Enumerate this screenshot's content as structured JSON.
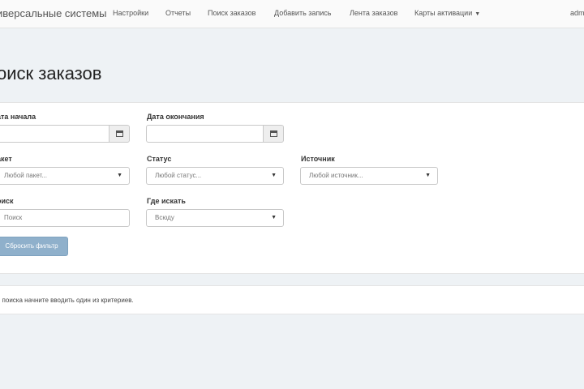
{
  "navbar": {
    "brand": "иверсальные системы",
    "items": [
      "Настройки",
      "Отчеты",
      "Поиск заказов",
      "Добавить запись",
      "Лента заказов",
      "Карты активации"
    ],
    "user": "adm"
  },
  "page_title": "оиск заказов",
  "filters": {
    "start_date": {
      "label": "ата начала",
      "value": ""
    },
    "end_date": {
      "label": "Дата окончания",
      "value": ""
    },
    "package": {
      "label": "акет",
      "selected": "Любой пакет..."
    },
    "status": {
      "label": "Статус",
      "selected": "Любой статус..."
    },
    "source": {
      "label": "Источник",
      "selected": "Любой источник..."
    },
    "search": {
      "label": "оиск",
      "placeholder": "Поиск"
    },
    "where": {
      "label": "Где искать",
      "selected": "Всюду"
    },
    "reset_label": "Сбросить фильтр"
  },
  "hint": "я поиска начните вводить один из критериев.",
  "colors": {
    "button": "#8fb0cb",
    "background": "#eef2f5"
  }
}
